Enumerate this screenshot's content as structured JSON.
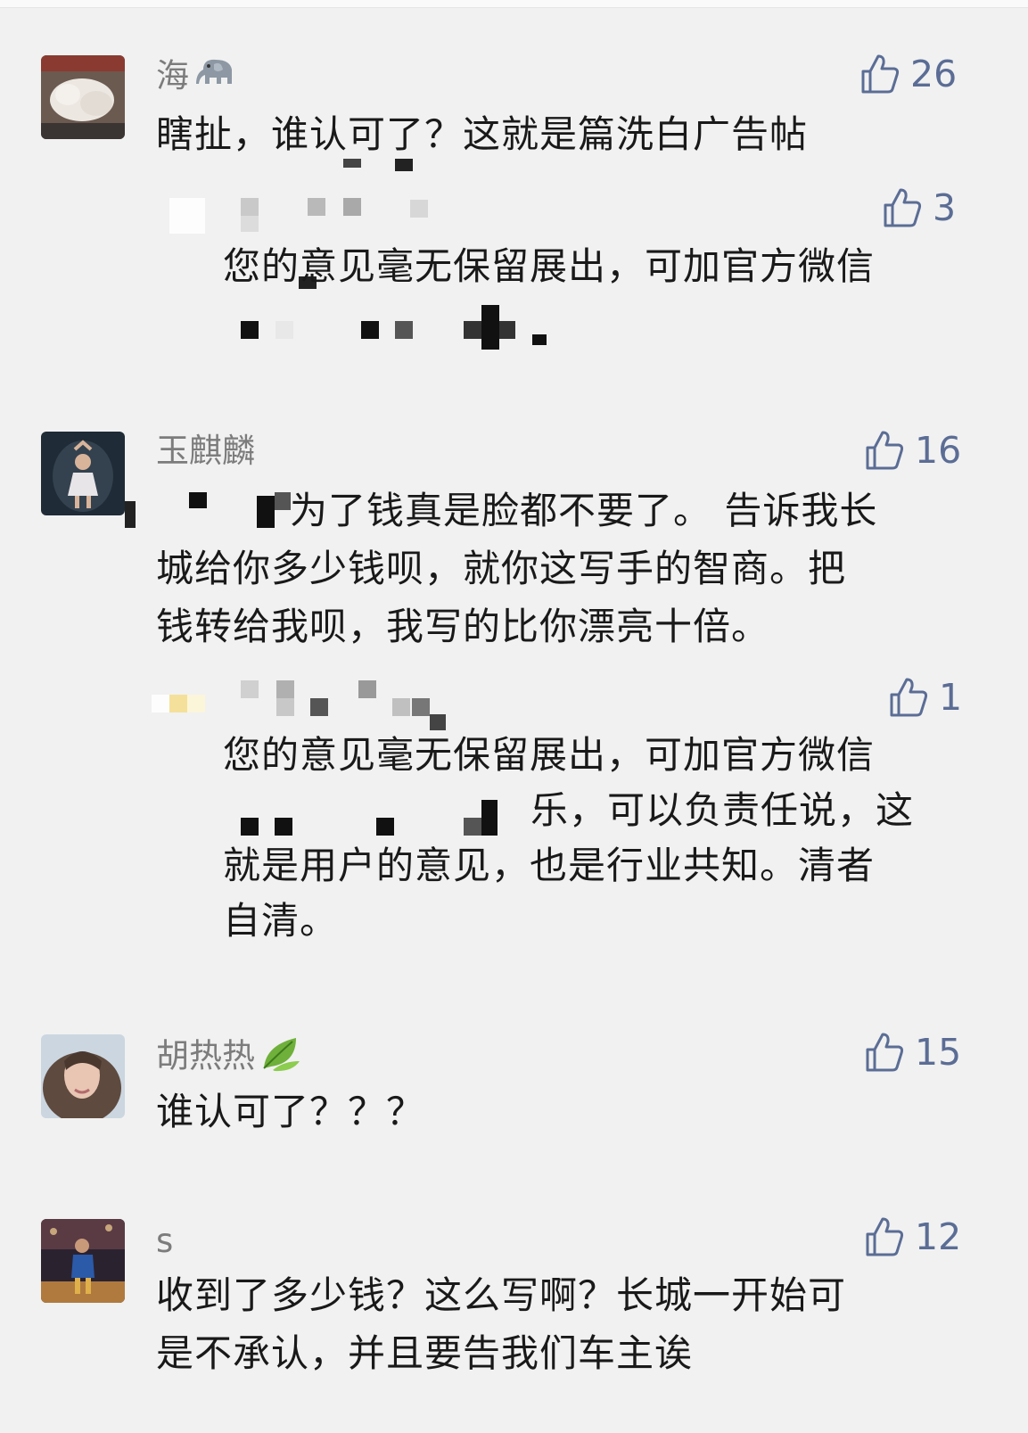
{
  "comments": [
    {
      "name": "海",
      "likes": "26",
      "text": "瞎扯，谁认可了？这就是篇洗白广告帖",
      "reply": {
        "likes": "3",
        "line1": "您的意见毫无保留展出，可加官方微信"
      }
    },
    {
      "name": "玉麒麟",
      "likes": "16",
      "text_l1": "为了钱真是脸都不要了。 告诉我长",
      "text_l2": "城给你多少钱呗，就你这写手的智商。把",
      "text_l3": "钱转给我呗，我写的比你漂亮十倍。",
      "reply": {
        "likes": "1",
        "line1": "您的意见毫无保留展出，可加官方微信",
        "line2": "乐，可以负责任说，这",
        "line3": "就是用户的意见，也是行业共知。清者",
        "line4": "自清。"
      }
    },
    {
      "name": "胡热热",
      "likes": "15",
      "text": "谁认可了？？？"
    },
    {
      "name": "s",
      "likes": "12",
      "text_l1": "收到了多少钱？这么写啊？长城一开始可",
      "text_l2": "是不承认，并且要告我们车主诶"
    }
  ],
  "icons": {
    "like": "thumbs-up-icon",
    "elephant": "elephant-emoji",
    "leaf": "leaf-emoji"
  },
  "colors": {
    "background": "#f1f1f1",
    "name": "#7c7c7c",
    "like": "#5b6d95",
    "text": "#191919"
  }
}
